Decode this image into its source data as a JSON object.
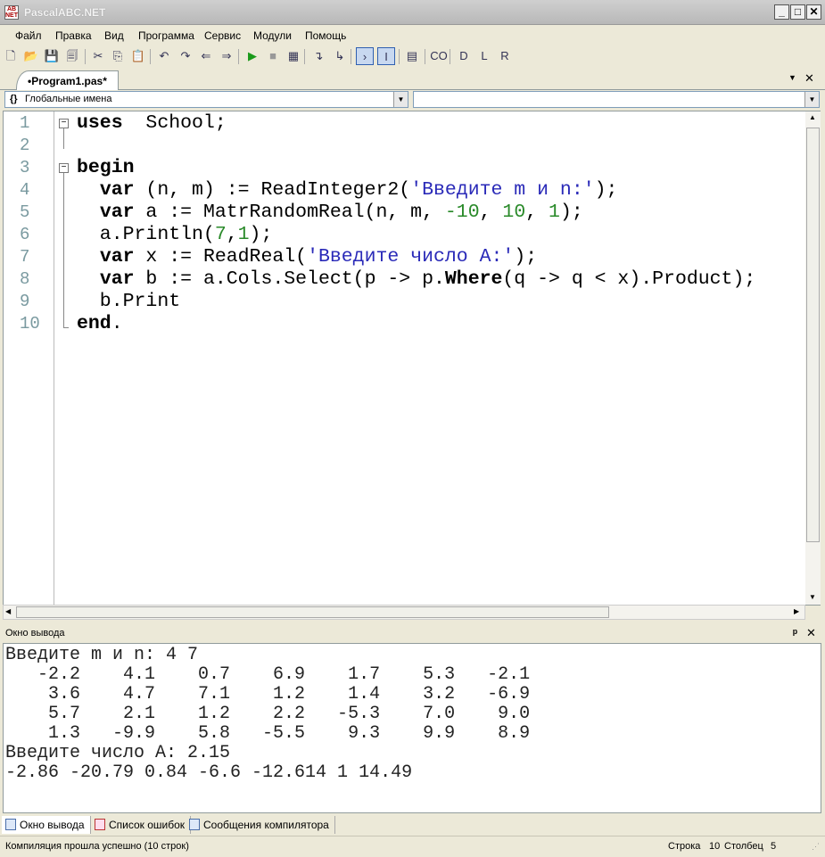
{
  "window": {
    "title": "PascalABC.NET",
    "minimize": "_",
    "maximize": "□",
    "close": "✕"
  },
  "menu": [
    "Файл",
    "Правка",
    "Вид",
    "Программа",
    "Сервис",
    "Модули",
    "Помощь"
  ],
  "toolbar": [
    {
      "name": "new-file-icon",
      "g": "🗋"
    },
    {
      "name": "open-icon",
      "g": "📂"
    },
    {
      "name": "save-icon",
      "g": "💾"
    },
    {
      "name": "save-all-icon",
      "g": "🗐"
    },
    {
      "name": "cut-icon",
      "g": "✂"
    },
    {
      "name": "copy-icon",
      "g": "⎘"
    },
    {
      "name": "paste-icon",
      "g": "📋"
    },
    {
      "name": "undo-icon",
      "g": "↶"
    },
    {
      "name": "redo-icon",
      "g": "↷"
    },
    {
      "name": "format-icon",
      "g": "⇐"
    },
    {
      "name": "format2-icon",
      "g": "⇒"
    },
    {
      "name": "run-icon",
      "g": "▶"
    },
    {
      "name": "stop-icon",
      "g": "■"
    },
    {
      "name": "debug-icon",
      "g": "▦"
    },
    {
      "name": "step-into-icon",
      "g": "↴"
    },
    {
      "name": "step-over-icon",
      "g": "↳"
    },
    {
      "name": "console-icon",
      "g": "›"
    },
    {
      "name": "text-icon",
      "g": "I"
    },
    {
      "name": "form-icon",
      "g": "▤"
    },
    {
      "name": "code-icon",
      "g": "CO"
    },
    {
      "name": "snippet-d-icon",
      "g": "D"
    },
    {
      "name": "snippet-l-icon",
      "g": "L"
    },
    {
      "name": "snippet-r-icon",
      "g": "R"
    }
  ],
  "tab": {
    "label": "•Program1.pas*",
    "menu": "▼",
    "close": "✕"
  },
  "scope_combo": {
    "icon": "{}",
    "value": "Глобальные имена"
  },
  "member_combo": {
    "value": ""
  },
  "editor": {
    "line_numbers": [
      "1",
      "2",
      "3",
      "4",
      "5",
      "6",
      "7",
      "8",
      "9",
      "10"
    ],
    "lines": [
      [
        [
          "k",
          "uses"
        ],
        [
          "",
          "  School;"
        ]
      ],
      [],
      [
        [
          "k",
          "begin"
        ]
      ],
      [
        [
          "",
          "  "
        ],
        [
          "k",
          "var"
        ],
        [
          "",
          " (n, m) := ReadInteger2("
        ],
        [
          "s",
          "'Введите m и n:'"
        ],
        [
          "",
          ");"
        ]
      ],
      [
        [
          "",
          "  "
        ],
        [
          "k",
          "var"
        ],
        [
          "",
          " a := MatrRandomReal(n, m, "
        ],
        [
          "n",
          "-10"
        ],
        [
          "",
          ", "
        ],
        [
          "n",
          "10"
        ],
        [
          "",
          ", "
        ],
        [
          "n",
          "1"
        ],
        [
          "",
          ");"
        ]
      ],
      [
        [
          "",
          "  a.Println("
        ],
        [
          "n",
          "7"
        ],
        [
          "",
          ","
        ],
        [
          "n",
          "1"
        ],
        [
          "",
          ");"
        ]
      ],
      [
        [
          "",
          "  "
        ],
        [
          "k",
          "var"
        ],
        [
          "",
          " x := ReadReal("
        ],
        [
          "s",
          "'Введите число A:'"
        ],
        [
          "",
          ");"
        ]
      ],
      [
        [
          "",
          "  "
        ],
        [
          "k",
          "var"
        ],
        [
          "",
          " b := a.Cols.Select(p -> p."
        ],
        [
          "k",
          "Where"
        ],
        [
          "",
          "(q -> q < x).Product);"
        ]
      ],
      [
        [
          "",
          "  b.Print"
        ]
      ],
      [
        [
          "k",
          "end"
        ],
        [
          "",
          "."
        ]
      ]
    ]
  },
  "output_panel": {
    "title": "Окно вывода",
    "pin": "ᵖ",
    "close": "✕",
    "lines": [
      "Введите m и n: 4 7",
      "   -2.2    4.1    0.7    6.9    1.7    5.3   -2.1",
      "    3.6    4.7    7.1    1.2    1.4    3.2   -6.9",
      "    5.7    2.1    1.2    2.2   -5.3    7.0    9.0",
      "    1.3   -9.9    5.8   -5.5    9.3    9.9    8.9",
      "Введите число A: 2.15",
      "-2.86 -20.79 0.84 -6.6 -12.614 1 14.49"
    ]
  },
  "bottom_tabs": [
    "Окно вывода",
    "Список ошибок",
    "Сообщения компилятора"
  ],
  "status": {
    "message": "Компиляция прошла успешно (10 строк)",
    "row_label": "Строка",
    "row": "10",
    "col_label": "Столбец",
    "col": "5"
  }
}
